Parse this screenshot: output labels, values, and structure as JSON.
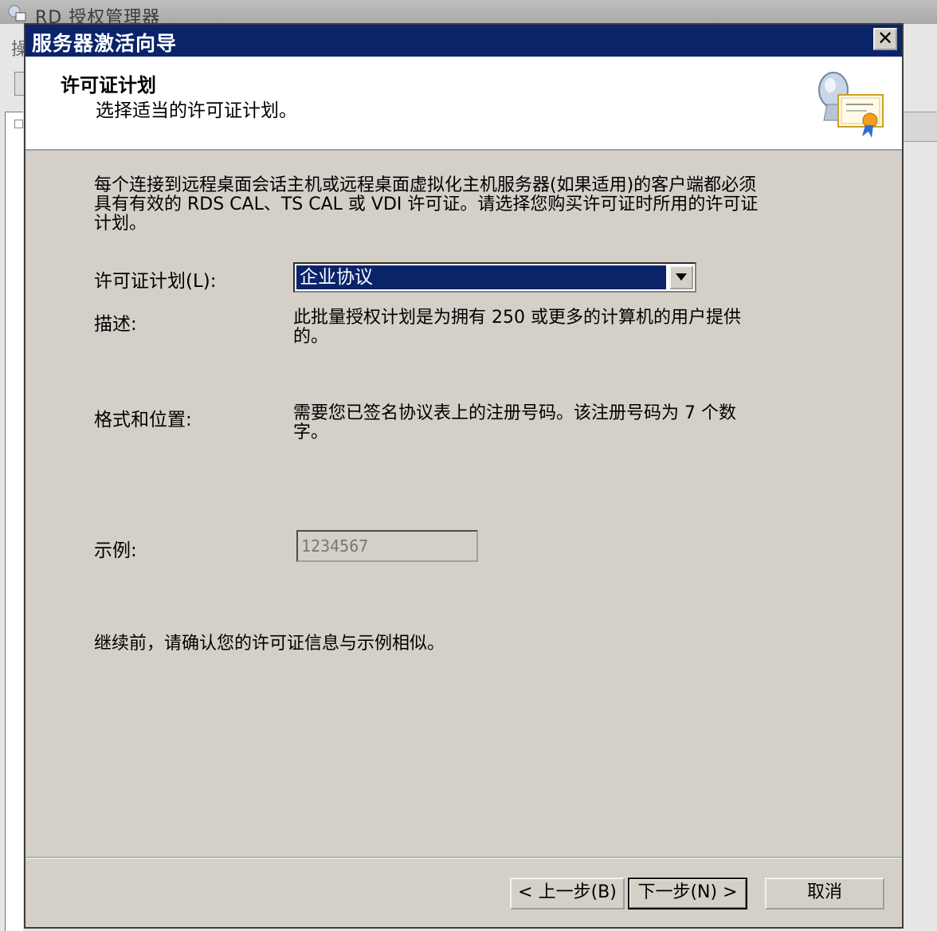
{
  "background_window": {
    "title": "RD 授权管理器",
    "menu_initial": "操"
  },
  "dialog": {
    "title": "服务器激活向导",
    "close_glyph": "✕",
    "header": {
      "title": "许可证计划",
      "subtitle": "选择适当的许可证计划。"
    },
    "intro": "每个连接到远程桌面会话主机或远程桌面虚拟化主机服务器(如果适用)的客户端都必须具有有效的 RDS CAL、TS CAL 或 VDI 许可证。请选择您购买许可证时所用的许可证计划。",
    "license_plan": {
      "label": "许可证计划(L):",
      "selected": "企业协议"
    },
    "description": {
      "label": "描述:",
      "text": "此批量授权计划是为拥有 250 或更多的计算机的用户提供的。"
    },
    "format": {
      "label": "格式和位置:",
      "text": "需要您已签名协议表上的注册号码。该注册号码为 7 个数字。"
    },
    "example": {
      "label": "示例:",
      "value": "1234567"
    },
    "confirm_text": "继续前，请确认您的许可证信息与示例相似。",
    "buttons": {
      "back": "< 上一步(B)",
      "next": "下一步(N) >",
      "cancel": "取消"
    }
  },
  "colors": {
    "titlebar": "#0a246a",
    "dialog_bg": "#d4d0c8",
    "selection": "#0a246a"
  },
  "icons": [
    "app-icon",
    "close-icon",
    "certificate-icon",
    "dropdown-arrow-icon"
  ]
}
